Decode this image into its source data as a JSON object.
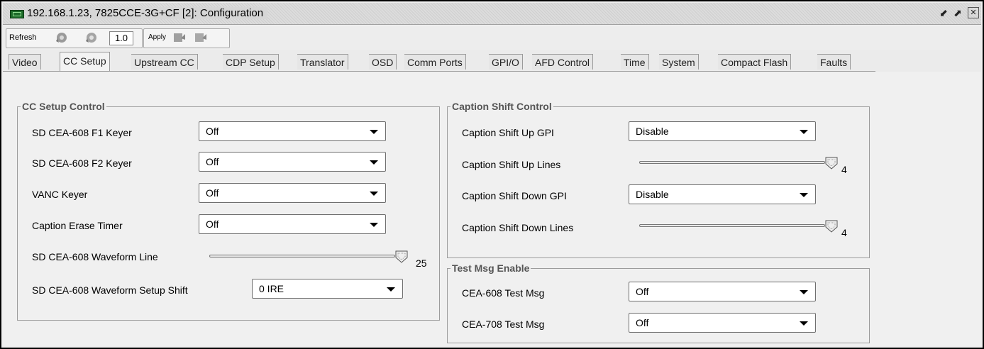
{
  "window": {
    "title": "192.168.1.23, 7825CCE-3G+CF  [2]: Configuration"
  },
  "toolbar": {
    "refresh_label": "Refresh",
    "zoom_value": "1.0",
    "apply_label": "Apply"
  },
  "tabs": [
    "Video",
    "CC Setup",
    "Upstream CC",
    "CDP Setup",
    "Translator",
    "OSD",
    "Comm Ports",
    "GPI/O",
    "AFD Control",
    "Time",
    "System",
    "Compact Flash",
    "Faults"
  ],
  "active_tab": "CC Setup",
  "cc_setup": {
    "title": "CC Setup Control",
    "f1_label": "SD CEA-608 F1 Keyer",
    "f1_value": "Off",
    "f2_label": "SD CEA-608 F2 Keyer",
    "f2_value": "Off",
    "vanc_label": "VANC Keyer",
    "vanc_value": "Off",
    "erase_label": "Caption Erase Timer",
    "erase_value": "Off",
    "wfline_label": "SD CEA-608 Waveform Line",
    "wfline_value": "25",
    "wfshift_label": "SD CEA-608 Waveform Setup Shift",
    "wfshift_value": "0 IRE"
  },
  "caption_shift": {
    "title": "Caption Shift Control",
    "up_gpi_label": "Caption Shift Up GPI",
    "up_gpi_value": "Disable",
    "up_lines_label": "Caption Shift Up Lines",
    "up_lines_value": "4",
    "down_gpi_label": "Caption Shift Down GPI",
    "down_gpi_value": "Disable",
    "down_lines_label": "Caption Shift Down Lines",
    "down_lines_value": "4"
  },
  "test_msg": {
    "title": "Test Msg Enable",
    "cea608_label": "CEA-608 Test Msg",
    "cea608_value": "Off",
    "cea708_label": "CEA-708 Test Msg",
    "cea708_value": "Off"
  },
  "icons": {
    "window": "device-icon",
    "refresh": "refresh-gear-icon",
    "apply": "apply-icon",
    "restore": "restore-icon",
    "maximize": "maximize-icon",
    "close": "close-icon"
  }
}
